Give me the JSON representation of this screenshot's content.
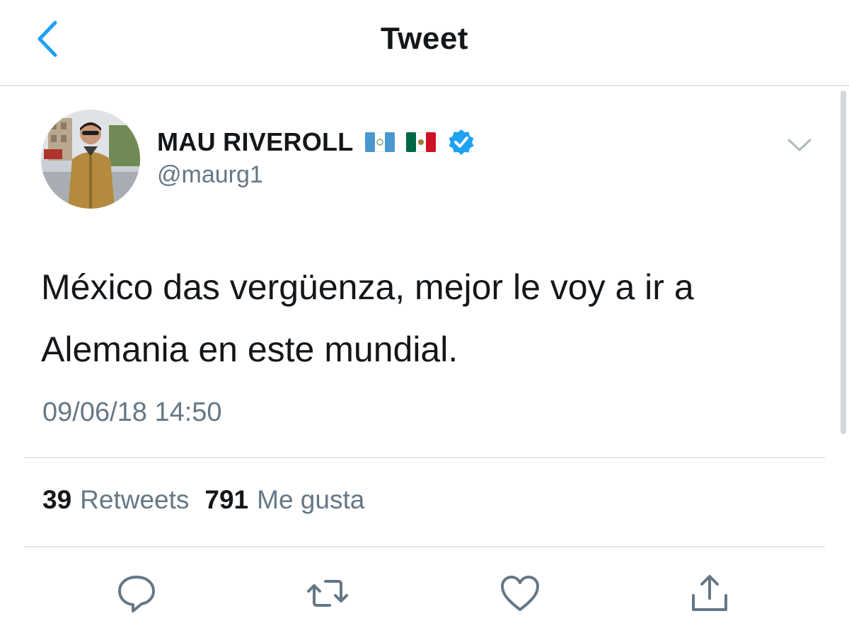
{
  "navbar": {
    "title": "Tweet",
    "back_icon": "chevron-left-icon"
  },
  "author": {
    "name": "MAU RIVEROLL",
    "handle": "@maurg1",
    "flags": [
      "guatemala-flag",
      "mexico-flag"
    ],
    "verified": true
  },
  "tweet": {
    "text": "México das vergüenza, mejor le voy a ir a\nAlemania en este mundial.",
    "timestamp": "09/06/18 14:50"
  },
  "stats": {
    "retweets_count": "39",
    "retweets_label": "Retweets",
    "likes_count": "791",
    "likes_label": "Me gusta"
  },
  "actions": [
    "reply-icon",
    "retweet-icon",
    "like-icon",
    "share-icon"
  ],
  "colors": {
    "accent": "#1da1f2",
    "text": "#14171a",
    "secondary_text": "#657786",
    "divider": "#e1e8ed"
  }
}
